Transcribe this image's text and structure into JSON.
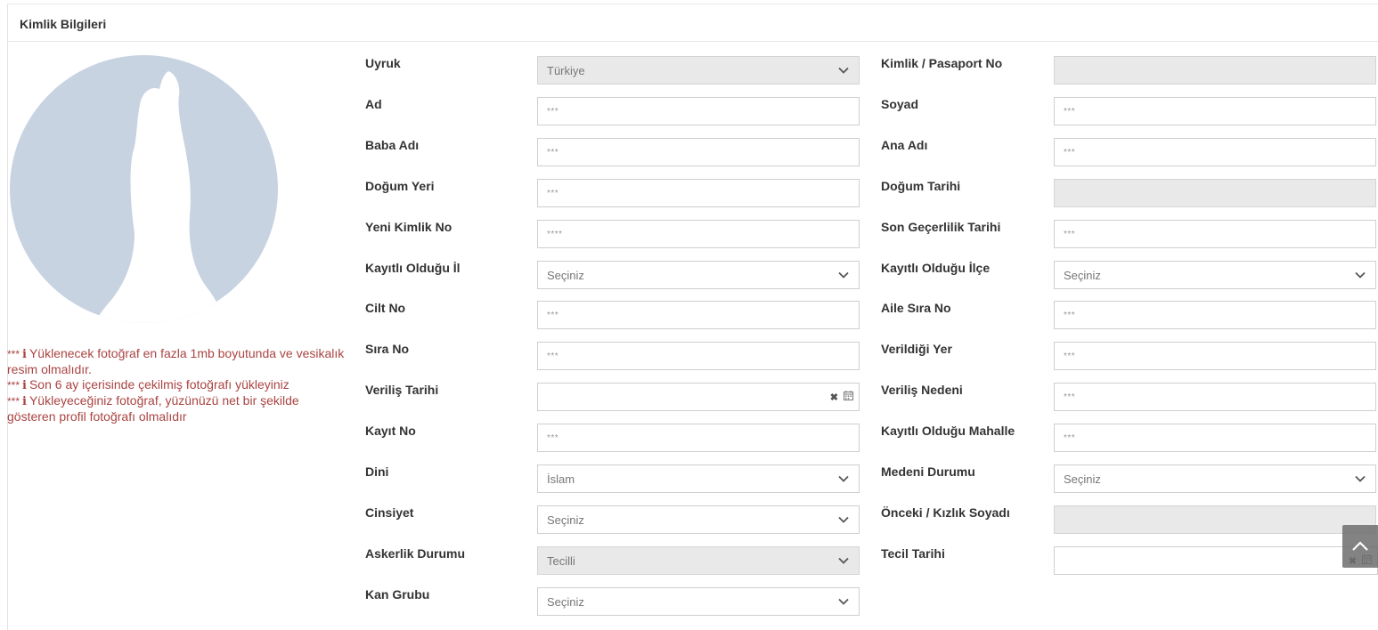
{
  "panel": {
    "title": "Kimlik Bilgileri"
  },
  "photo_notes": [
    {
      "stars": "***",
      "text": "Yüklenecek fotoğraf en fazla 1mb boyutunda ve vesikalık resim olmalıdır."
    },
    {
      "stars": "***",
      "text": "Son 6 ay içerisinde çekilmiş fotoğrafı yükleyiniz"
    },
    {
      "stars": "***",
      "text": "Yükleyeceğiniz fotoğraf, yüzünüzü net bir şekilde gösteren profil fotoğrafı olmalıdır"
    }
  ],
  "left_fields": [
    {
      "label": "Uyruk",
      "type": "select",
      "value": "Türkiye",
      "disabled": true
    },
    {
      "label": "Ad",
      "type": "text",
      "value": "***"
    },
    {
      "label": "Baba Adı",
      "type": "text",
      "value": "***"
    },
    {
      "label": "Doğum Yeri",
      "type": "text",
      "value": "***"
    },
    {
      "label": "Yeni Kimlik No",
      "type": "text",
      "value": "****"
    },
    {
      "label": "Kayıtlı Olduğu İl",
      "type": "select",
      "value": "Seçiniz"
    },
    {
      "label": "Cilt No",
      "type": "text",
      "value": "***"
    },
    {
      "label": "Sıra No",
      "type": "text",
      "value": "***"
    },
    {
      "label": "Veriliş Tarihi",
      "type": "date",
      "value": ""
    },
    {
      "label": "Kayıt No",
      "type": "text",
      "value": "***"
    },
    {
      "label": "Dini",
      "type": "select",
      "value": "İslam"
    },
    {
      "label": "Cinsiyet",
      "type": "select",
      "value": "Seçiniz"
    },
    {
      "label": "Askerlik Durumu",
      "type": "select",
      "value": "Tecilli",
      "disabled": true
    },
    {
      "label": "Kan Grubu",
      "type": "select",
      "value": "Seçiniz"
    }
  ],
  "right_fields": [
    {
      "label": "Kimlik / Pasaport No",
      "type": "text",
      "value": "",
      "disabled": true
    },
    {
      "label": "Soyad",
      "type": "text",
      "value": "***"
    },
    {
      "label": "Ana Adı",
      "type": "text",
      "value": "***"
    },
    {
      "label": "Doğum Tarihi",
      "type": "text",
      "value": "",
      "disabled": true
    },
    {
      "label": "Son Geçerlilik Tarihi",
      "type": "text",
      "value": "***"
    },
    {
      "label": "Kayıtlı Olduğu İlçe",
      "type": "select",
      "value": "Seçiniz"
    },
    {
      "label": "Aile Sıra No",
      "type": "text",
      "value": "***"
    },
    {
      "label": "Verildiği Yer",
      "type": "text",
      "value": "***"
    },
    {
      "label": "Veriliş Nedeni",
      "type": "text",
      "value": "***"
    },
    {
      "label": "Kayıtlı Olduğu Mahalle",
      "type": "text",
      "value": "***"
    },
    {
      "label": "Medeni Durumu",
      "type": "select",
      "value": "Seçiniz"
    },
    {
      "label": "Önceki / Kızlık Soyadı",
      "type": "text",
      "value": "",
      "disabled": true
    },
    {
      "label": "Tecil Tarihi",
      "type": "date",
      "value": ""
    }
  ],
  "icons": {
    "chevron": "chevron-down-icon",
    "clear": "clear-x-icon",
    "calendar": "calendar-icon",
    "scroll_top": "chevron-up-icon"
  },
  "colors": {
    "note_text": "#a94442",
    "avatar_bg": "#c8d3e2",
    "disabled_bg": "#e9e9e9"
  }
}
